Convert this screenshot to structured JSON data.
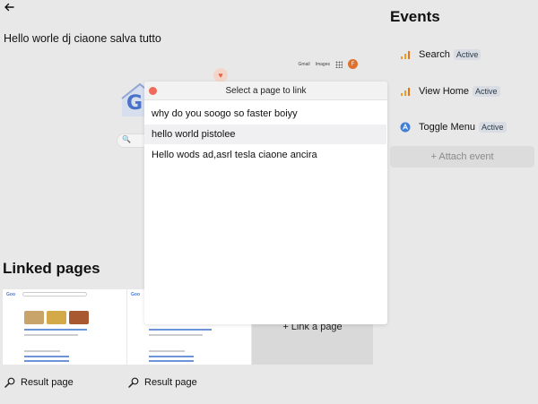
{
  "page": {
    "title": "Hello worle dj ciaone salva tutto"
  },
  "preview": {
    "links": [
      "Gmail",
      "Images"
    ],
    "avatar_letter": "F",
    "search_glyph": "🔍"
  },
  "events": {
    "title": "Events",
    "items": [
      {
        "label": "Search",
        "badge": "Active",
        "icon": "analytics-icon"
      },
      {
        "label": "View Home",
        "badge": "Active",
        "icon": "analytics-icon"
      },
      {
        "label": "Toggle Menu",
        "badge": "Active",
        "icon": "app-icon"
      }
    ],
    "attach_label": "+ Attach event"
  },
  "linked": {
    "title": "Linked pages",
    "pages": [
      {
        "label": "Result page"
      },
      {
        "label": "Result page"
      }
    ],
    "link_label": "+ Link a page"
  },
  "modal": {
    "title": "Select a page to link",
    "items": [
      {
        "label": "why do you soogo so faster boiyy",
        "selected": false
      },
      {
        "label": "hello world pistolee",
        "selected": true
      },
      {
        "label": "Hello wods ad,asrl tesla ciaone ancira",
        "selected": false
      }
    ]
  },
  "colors": {
    "background": "#e8e8e8",
    "modal_close": "#ef6a5a",
    "analytics_orange": "#f29b22",
    "app_blue": "#3f7fd8"
  }
}
